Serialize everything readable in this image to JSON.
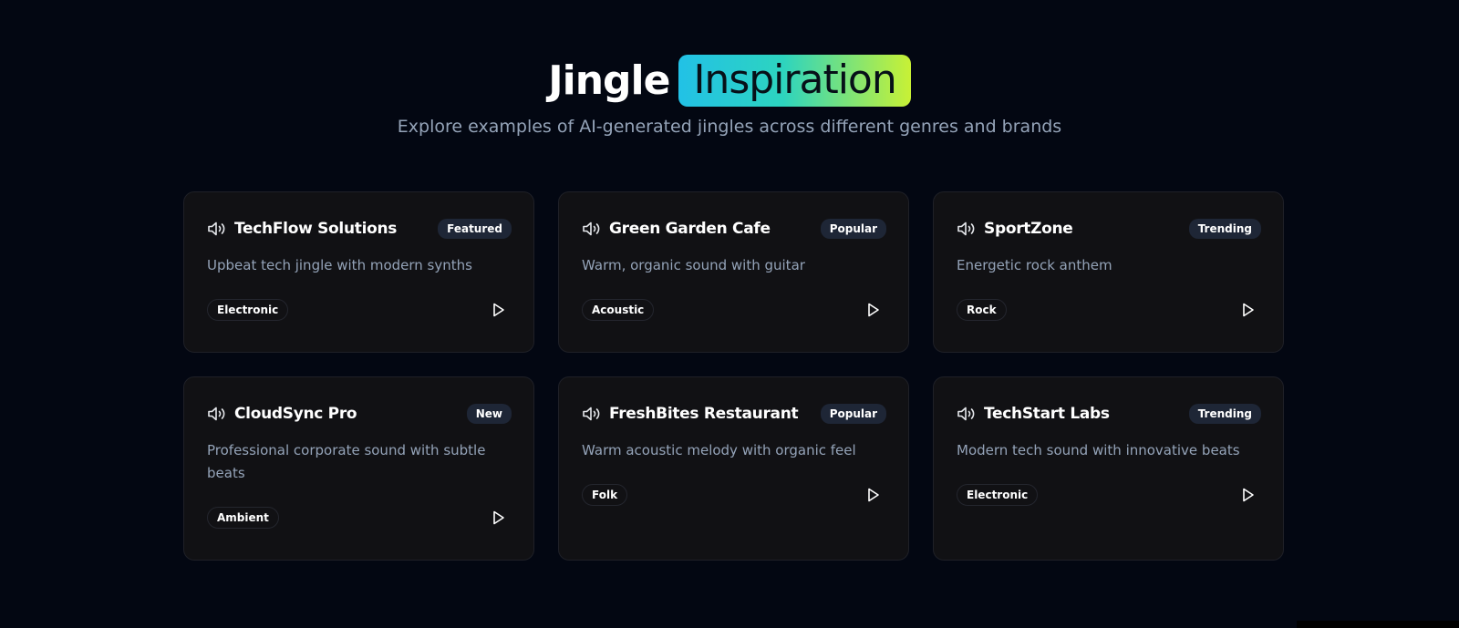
{
  "header": {
    "title_word": "Jingle",
    "title_highlight": "Inspiration",
    "subtitle": "Explore examples of AI-generated jingles across different genres and brands"
  },
  "cards": [
    {
      "name": "TechFlow Solutions",
      "badge": "Featured",
      "description": "Upbeat tech jingle with modern synths",
      "genre": "Electronic",
      "icon": "speaker-icon"
    },
    {
      "name": "Green Garden Cafe",
      "badge": "Popular",
      "description": "Warm, organic sound with guitar",
      "genre": "Acoustic",
      "icon": "speaker-icon"
    },
    {
      "name": "SportZone",
      "badge": "Trending",
      "description": "Energetic rock anthem",
      "genre": "Rock",
      "icon": "speaker-icon"
    },
    {
      "name": "CloudSync Pro",
      "badge": "New",
      "description": "Professional corporate sound with subtle beats",
      "genre": "Ambient",
      "icon": "speaker-icon"
    },
    {
      "name": "FreshBites Restaurant",
      "badge": "Popular",
      "description": "Warm acoustic melody with organic feel",
      "genre": "Folk",
      "icon": "speaker-icon"
    },
    {
      "name": "TechStart Labs",
      "badge": "Trending",
      "description": "Modern tech sound with innovative beats",
      "genre": "Electronic",
      "icon": "speaker-icon"
    }
  ],
  "colors": {
    "background": "#030712",
    "card": "#111114",
    "accent_gradient_start": "#22c1e6",
    "accent_gradient_end": "#c8f135",
    "muted_text": "#94a3b8"
  }
}
